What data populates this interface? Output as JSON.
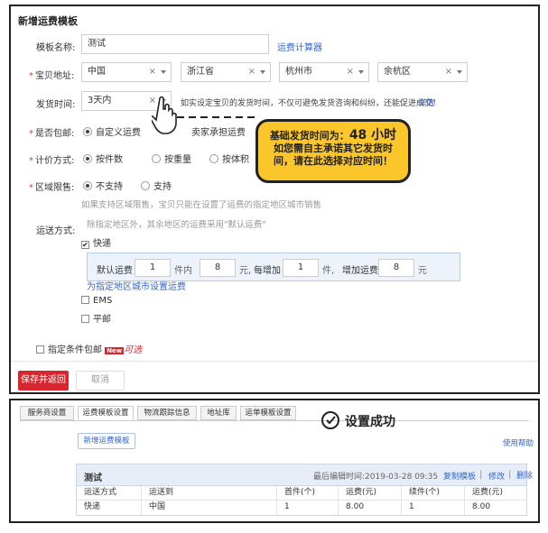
{
  "top": {
    "title": "新增运费模板",
    "name_label": "模板名称:",
    "name_value": "测试",
    "calc_link": "运费计算器",
    "address_label": "宝贝地址:",
    "address": [
      "中国",
      "浙江省",
      "杭州市",
      "余杭区"
    ],
    "ship_time_label": "发货时间:",
    "ship_time_value": "3天内",
    "ship_time_hint": "如实设定宝贝的发货时间，不仅可避免发货咨询和纠纷，还能促进成交！",
    "ship_time_detail": "详情",
    "free_label": "是否包邮:",
    "free_opt1": "自定义运费",
    "free_opt2": "卖家承担运费",
    "calc_label": "计价方式:",
    "calc_opts": [
      "按件数",
      "按重量",
      "按体积"
    ],
    "region_label": "区域限售:",
    "region_opts": [
      "不支持",
      "支持"
    ],
    "region_hint": "如果支持区域限售，宝贝只能在设置了运费的指定地区城市销售",
    "method_label": "运送方式:",
    "method_hint": "除指定地区外，其余地区的运费采用\"默认运费\"",
    "express_label": "快递",
    "fee": {
      "default_label": "默认运费",
      "first_qty": "1",
      "unit_within": "件内",
      "first_fee": "8",
      "yuan": "元,",
      "each_add_label": "每增加",
      "add_qty": "1",
      "unit_jian": "件,",
      "add_fee_label": "增加运费",
      "add_fee": "8",
      "yuan2": "元"
    },
    "set_region_link": "为指定地区城市设置运费",
    "ems_label": "EMS",
    "post_label": "平邮",
    "cond_free_label": "指定条件包邮",
    "new_badge": "New",
    "optional_text": "可选",
    "save_btn": "保存并返回",
    "cancel_btn": "取消"
  },
  "callout": {
    "line1a": "基础发货时间为：",
    "line1b": "48 小时",
    "line2": "如您需自主承诺其它发货时",
    "line3": "间，请在此选择对应时间！"
  },
  "bottom": {
    "tabs": [
      "服务商设置",
      "运费模板设置",
      "物流跟踪信息",
      "地址库",
      "运单模板设置"
    ],
    "success_text": "设置成功",
    "new_template_btn": "新增运费模板",
    "help_link": "使用帮助",
    "tpl_name": "测试",
    "last_edit": "最后编辑时间:2019-03-28 09:35",
    "copy_link": "复制模板",
    "edit_link": "修改",
    "delete_link": "删除",
    "columns": [
      "运送方式",
      "运送到",
      "首件(个)",
      "运费(元)",
      "续件(个)",
      "运费(元)"
    ],
    "rows": [
      [
        "快递",
        "中国",
        "1",
        "8.00",
        "1",
        "8.00"
      ]
    ]
  },
  "colors": {
    "accent_red": "#d7262d",
    "link_blue": "#3366cc",
    "callout_yellow": "#fbc62a"
  }
}
